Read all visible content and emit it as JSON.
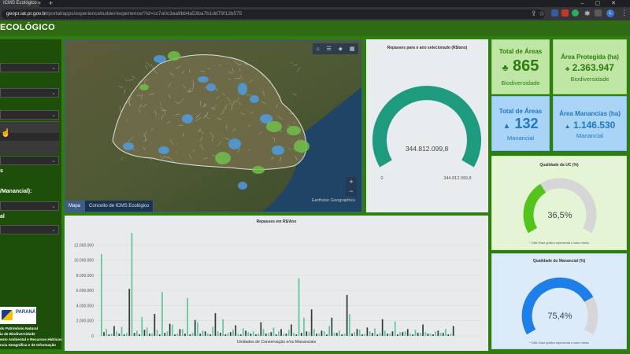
{
  "browser": {
    "tab_title": "ICMS Ecológico",
    "url_host": "geopr.iat.pr.gov.br",
    "url_path": "/portal/apps/experiencebuilder/experience/?id=cc7a0c3aa8bb4a53ba7b1dd79f12b575"
  },
  "app": {
    "title": "ECOLÓGICO"
  },
  "sidebar": {
    "labels": [
      "s",
      "/Manancial):",
      "al"
    ],
    "logo_text": "PARANÁ",
    "footer_lines": [
      "do Patrimônio Natural",
      "ia de Biodiversidade",
      "ento Ambiental e Recursos Hídricos",
      "ncia Geográfica e de Informação"
    ]
  },
  "map": {
    "tabs": [
      "Mapa",
      "Conceito de ICMS Ecológico"
    ],
    "credit": "Earthstar Geographics",
    "zoom_in": "+",
    "zoom_out": "−"
  },
  "gauge_repasses": {
    "title": "Repasses para o ano selecionado (R$/ano)",
    "value_label": "344.812.099,8",
    "min_label": "0",
    "max_label": "344.812.099,8",
    "fraction": 1.0,
    "color": "#1e9a7e"
  },
  "kpis": {
    "total_areas_bio": {
      "title": "Total de Áreas",
      "value": "865",
      "sub": "Biodiversidade",
      "icon": "tree-icon"
    },
    "area_protegida": {
      "title": "Área Protegida (ha)",
      "value": "2.363.947",
      "sub": "Biodiversidade",
      "icon": "tree-icon"
    },
    "total_areas_man": {
      "title": "Total de Áreas",
      "value": "132",
      "sub": "Manancial",
      "icon": "drop-icon"
    },
    "area_mananciais": {
      "title": "Área Manancias (ha)",
      "value": "1.146.530",
      "sub": "Manancial",
      "icon": "drop-icon"
    }
  },
  "quality_uc": {
    "title": "Qualidade da UC (%)",
    "value_label": "36,5%",
    "value": 36.5,
    "color": "#52c41a",
    "footnote": "* O88: Esse gráfico representa o valor médio"
  },
  "quality_man": {
    "title": "Qualidade do Manancial (%)",
    "value_label": "75,4%",
    "value": 75.4,
    "color": "#1e7fe8",
    "footnote": "* O88: Esse gráfico representa o valor médio"
  },
  "chart_data": {
    "type": "bar",
    "title": "Repasses em R$/Ano",
    "xlabel": "Unidades de Conservação e/ou Mananciais",
    "ylabel": "",
    "ylim": [
      0,
      14000000
    ],
    "yticks": [
      "0",
      "2.000.000",
      "4.000.000",
      "6.000.000",
      "8.000.000",
      "10.000.000",
      "12.000.000"
    ],
    "series": [
      {
        "color": "#5fc79a",
        "values": [
          10800000,
          900000,
          300000,
          600000,
          1200000,
          400000,
          13600000,
          700000,
          2500000,
          1100000,
          300000,
          800000,
          5800000,
          600000,
          1500000,
          300000,
          900000,
          5000000,
          400000,
          1800000,
          700000,
          300000,
          1200000,
          600000,
          2200000,
          400000,
          800000,
          300000,
          1000000,
          500000,
          600000,
          300000,
          900000,
          400000,
          1100000,
          600000,
          300000,
          800000,
          400000,
          7600000,
          2400000,
          500000,
          900000,
          300000,
          600000,
          1300000,
          400000,
          700000,
          300000,
          2900000,
          500000,
          800000,
          300000,
          600000,
          1000000,
          400000,
          700000,
          300000,
          1900000,
          500000,
          600000,
          300000,
          800000,
          400000,
          500000,
          300000,
          600000,
          400000,
          900000,
          300000
        ]
      },
      {
        "color": "#2f3b35",
        "values": [
          500000,
          200000,
          1300000,
          300000,
          200000,
          6200000,
          400000,
          200000,
          800000,
          300000,
          2900000,
          200000,
          400000,
          1600000,
          200000,
          900000,
          300000,
          200000,
          2100000,
          300000,
          600000,
          200000,
          3000000,
          400000,
          200000,
          500000,
          1400000,
          200000,
          700000,
          300000,
          200000,
          1800000,
          300000,
          500000,
          200000,
          900000,
          300000,
          1500000,
          200000,
          400000,
          600000,
          3500000,
          300000,
          700000,
          200000,
          2400000,
          400000,
          200000,
          5400000,
          300000,
          900000,
          200000,
          1100000,
          400000,
          200000,
          2200000,
          300000,
          600000,
          200000,
          500000,
          900000,
          200000,
          400000,
          1500000,
          300000,
          200000,
          700000,
          400000,
          200000,
          1300000
        ]
      }
    ]
  }
}
